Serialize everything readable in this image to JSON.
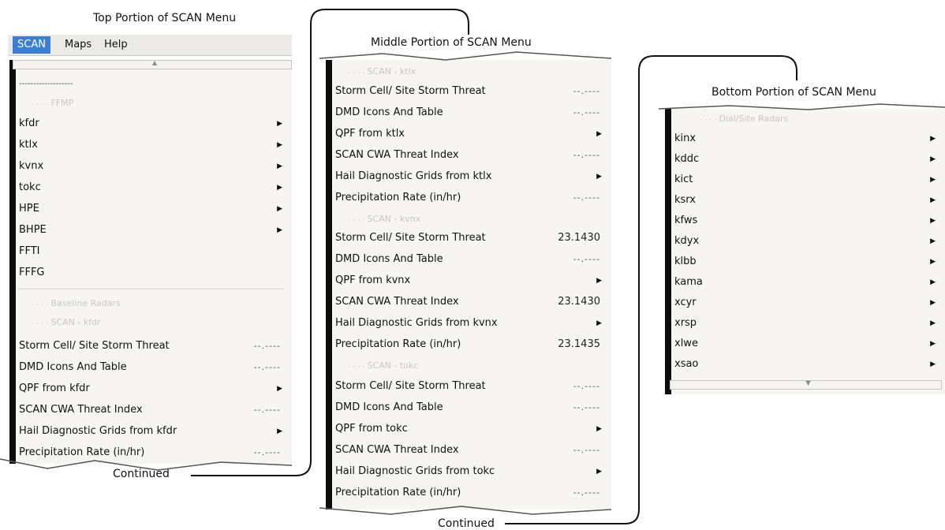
{
  "captions": {
    "top": "Top Portion of SCAN Menu",
    "middle": "Middle Portion of SCAN Menu",
    "bottom": "Bottom Portion of SCAN Menu",
    "continued_1": "Continued",
    "continued_2": "Continued"
  },
  "menubar": {
    "items": [
      "SCAN",
      "Maps",
      "Help"
    ]
  },
  "top_menu": {
    "dashes": "-------------------",
    "section_ffmp": "FFMP",
    "ffmp_items": [
      {
        "label": "kfdr",
        "submenu": true
      },
      {
        "label": "ktlx",
        "submenu": true
      },
      {
        "label": "kvnx",
        "submenu": true
      },
      {
        "label": "tokc",
        "submenu": true
      },
      {
        "label": "HPE",
        "submenu": true
      },
      {
        "label": "BHPE",
        "submenu": true
      },
      {
        "label": "FFTI",
        "submenu": false
      },
      {
        "label": "FFFG",
        "submenu": false
      }
    ],
    "section_baseline": "Baseline Radars",
    "section_scan": "SCAN - kfdr",
    "scan_items": [
      {
        "label": "Storm Cell/ Site Storm Threat",
        "value": "--.----"
      },
      {
        "label": "DMD Icons And Table",
        "value": "--.----"
      },
      {
        "label": "QPF from kfdr",
        "submenu": true
      },
      {
        "label": "SCAN CWA Threat Index",
        "value": "--.----"
      },
      {
        "label": "Hail Diagnostic Grids from kfdr",
        "submenu": true
      },
      {
        "label": "Precipitation Rate (in/hr)",
        "value": "--.----"
      }
    ]
  },
  "middle_menu": {
    "sections": [
      {
        "title": "SCAN - ktlx",
        "items": [
          {
            "label": "Storm Cell/ Site Storm Threat",
            "value": "--.----"
          },
          {
            "label": "DMD Icons And Table",
            "value": "--.----"
          },
          {
            "label": "QPF from ktlx",
            "submenu": true
          },
          {
            "label": "SCAN CWA Threat Index",
            "value": "--.----"
          },
          {
            "label": "Hail Diagnostic Grids from ktlx",
            "submenu": true
          },
          {
            "label": "Precipitation Rate (in/hr)",
            "value": "--.----"
          }
        ]
      },
      {
        "title": "SCAN - kvnx",
        "items": [
          {
            "label": "Storm Cell/ Site Storm Threat",
            "value": "23.1430"
          },
          {
            "label": "DMD Icons And Table",
            "value": "--.----"
          },
          {
            "label": "QPF from kvnx",
            "submenu": true
          },
          {
            "label": "SCAN CWA Threat Index",
            "value": "23.1430"
          },
          {
            "label": "Hail Diagnostic Grids from kvnx",
            "submenu": true
          },
          {
            "label": "Precipitation Rate (in/hr)",
            "value": "23.1435"
          }
        ]
      },
      {
        "title": "SCAN - tokc",
        "items": [
          {
            "label": "Storm Cell/ Site Storm Threat",
            "value": "--.----"
          },
          {
            "label": "DMD Icons And Table",
            "value": "--.----"
          },
          {
            "label": "QPF from tokc",
            "submenu": true
          },
          {
            "label": "SCAN CWA Threat Index",
            "value": "--.----"
          },
          {
            "label": "Hail Diagnostic Grids from tokc",
            "submenu": true
          },
          {
            "label": "Precipitation Rate (in/hr)",
            "value": "--.----"
          }
        ]
      }
    ]
  },
  "bottom_menu": {
    "section_title": "Dial/Site Radars",
    "items": [
      "kinx",
      "kddc",
      "kict",
      "ksrx",
      "kfws",
      "kdyx",
      "klbb",
      "kama",
      "xcyr",
      "xrsp",
      "xlwe",
      "xsao"
    ]
  },
  "icons": {
    "submenu": "triangle-right-icon",
    "scroll": "scroll-arrow-icon"
  },
  "colors": {
    "menubar_active": "#3b7fd4",
    "menu_bg": "#f6f5f2"
  }
}
